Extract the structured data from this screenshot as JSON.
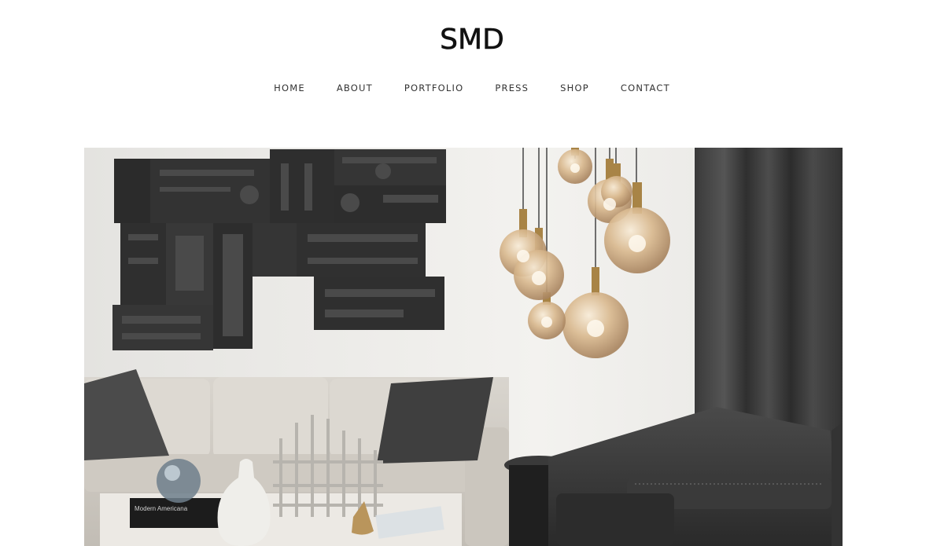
{
  "header": {
    "logo": "SMD"
  },
  "nav": {
    "items": [
      {
        "label": "HOME"
      },
      {
        "label": "ABOUT"
      },
      {
        "label": "PORTFOLIO"
      },
      {
        "label": "PRESS"
      },
      {
        "label": "SHOP"
      },
      {
        "label": "CONTACT"
      }
    ]
  },
  "hero": {
    "book_title": "Modern Americana"
  },
  "colors": {
    "text": "#111111",
    "nav_text": "#333333",
    "background": "#ffffff"
  }
}
